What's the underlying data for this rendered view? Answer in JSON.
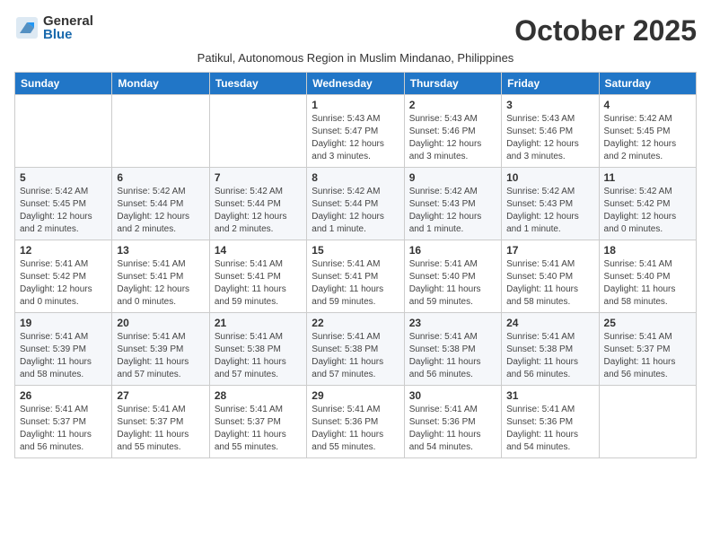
{
  "logo": {
    "general": "General",
    "blue": "Blue"
  },
  "title": "October 2025",
  "subtitle": "Patikul, Autonomous Region in Muslim Mindanao, Philippines",
  "weekdays": [
    "Sunday",
    "Monday",
    "Tuesday",
    "Wednesday",
    "Thursday",
    "Friday",
    "Saturday"
  ],
  "weeks": [
    [
      {
        "day": "",
        "sunrise": "",
        "sunset": "",
        "daylight": ""
      },
      {
        "day": "",
        "sunrise": "",
        "sunset": "",
        "daylight": ""
      },
      {
        "day": "",
        "sunrise": "",
        "sunset": "",
        "daylight": ""
      },
      {
        "day": "1",
        "sunrise": "Sunrise: 5:43 AM",
        "sunset": "Sunset: 5:47 PM",
        "daylight": "Daylight: 12 hours and 3 minutes."
      },
      {
        "day": "2",
        "sunrise": "Sunrise: 5:43 AM",
        "sunset": "Sunset: 5:46 PM",
        "daylight": "Daylight: 12 hours and 3 minutes."
      },
      {
        "day": "3",
        "sunrise": "Sunrise: 5:43 AM",
        "sunset": "Sunset: 5:46 PM",
        "daylight": "Daylight: 12 hours and 3 minutes."
      },
      {
        "day": "4",
        "sunrise": "Sunrise: 5:42 AM",
        "sunset": "Sunset: 5:45 PM",
        "daylight": "Daylight: 12 hours and 2 minutes."
      }
    ],
    [
      {
        "day": "5",
        "sunrise": "Sunrise: 5:42 AM",
        "sunset": "Sunset: 5:45 PM",
        "daylight": "Daylight: 12 hours and 2 minutes."
      },
      {
        "day": "6",
        "sunrise": "Sunrise: 5:42 AM",
        "sunset": "Sunset: 5:44 PM",
        "daylight": "Daylight: 12 hours and 2 minutes."
      },
      {
        "day": "7",
        "sunrise": "Sunrise: 5:42 AM",
        "sunset": "Sunset: 5:44 PM",
        "daylight": "Daylight: 12 hours and 2 minutes."
      },
      {
        "day": "8",
        "sunrise": "Sunrise: 5:42 AM",
        "sunset": "Sunset: 5:44 PM",
        "daylight": "Daylight: 12 hours and 1 minute."
      },
      {
        "day": "9",
        "sunrise": "Sunrise: 5:42 AM",
        "sunset": "Sunset: 5:43 PM",
        "daylight": "Daylight: 12 hours and 1 minute."
      },
      {
        "day": "10",
        "sunrise": "Sunrise: 5:42 AM",
        "sunset": "Sunset: 5:43 PM",
        "daylight": "Daylight: 12 hours and 1 minute."
      },
      {
        "day": "11",
        "sunrise": "Sunrise: 5:42 AM",
        "sunset": "Sunset: 5:42 PM",
        "daylight": "Daylight: 12 hours and 0 minutes."
      }
    ],
    [
      {
        "day": "12",
        "sunrise": "Sunrise: 5:41 AM",
        "sunset": "Sunset: 5:42 PM",
        "daylight": "Daylight: 12 hours and 0 minutes."
      },
      {
        "day": "13",
        "sunrise": "Sunrise: 5:41 AM",
        "sunset": "Sunset: 5:41 PM",
        "daylight": "Daylight: 12 hours and 0 minutes."
      },
      {
        "day": "14",
        "sunrise": "Sunrise: 5:41 AM",
        "sunset": "Sunset: 5:41 PM",
        "daylight": "Daylight: 11 hours and 59 minutes."
      },
      {
        "day": "15",
        "sunrise": "Sunrise: 5:41 AM",
        "sunset": "Sunset: 5:41 PM",
        "daylight": "Daylight: 11 hours and 59 minutes."
      },
      {
        "day": "16",
        "sunrise": "Sunrise: 5:41 AM",
        "sunset": "Sunset: 5:40 PM",
        "daylight": "Daylight: 11 hours and 59 minutes."
      },
      {
        "day": "17",
        "sunrise": "Sunrise: 5:41 AM",
        "sunset": "Sunset: 5:40 PM",
        "daylight": "Daylight: 11 hours and 58 minutes."
      },
      {
        "day": "18",
        "sunrise": "Sunrise: 5:41 AM",
        "sunset": "Sunset: 5:40 PM",
        "daylight": "Daylight: 11 hours and 58 minutes."
      }
    ],
    [
      {
        "day": "19",
        "sunrise": "Sunrise: 5:41 AM",
        "sunset": "Sunset: 5:39 PM",
        "daylight": "Daylight: 11 hours and 58 minutes."
      },
      {
        "day": "20",
        "sunrise": "Sunrise: 5:41 AM",
        "sunset": "Sunset: 5:39 PM",
        "daylight": "Daylight: 11 hours and 57 minutes."
      },
      {
        "day": "21",
        "sunrise": "Sunrise: 5:41 AM",
        "sunset": "Sunset: 5:38 PM",
        "daylight": "Daylight: 11 hours and 57 minutes."
      },
      {
        "day": "22",
        "sunrise": "Sunrise: 5:41 AM",
        "sunset": "Sunset: 5:38 PM",
        "daylight": "Daylight: 11 hours and 57 minutes."
      },
      {
        "day": "23",
        "sunrise": "Sunrise: 5:41 AM",
        "sunset": "Sunset: 5:38 PM",
        "daylight": "Daylight: 11 hours and 56 minutes."
      },
      {
        "day": "24",
        "sunrise": "Sunrise: 5:41 AM",
        "sunset": "Sunset: 5:38 PM",
        "daylight": "Daylight: 11 hours and 56 minutes."
      },
      {
        "day": "25",
        "sunrise": "Sunrise: 5:41 AM",
        "sunset": "Sunset: 5:37 PM",
        "daylight": "Daylight: 11 hours and 56 minutes."
      }
    ],
    [
      {
        "day": "26",
        "sunrise": "Sunrise: 5:41 AM",
        "sunset": "Sunset: 5:37 PM",
        "daylight": "Daylight: 11 hours and 56 minutes."
      },
      {
        "day": "27",
        "sunrise": "Sunrise: 5:41 AM",
        "sunset": "Sunset: 5:37 PM",
        "daylight": "Daylight: 11 hours and 55 minutes."
      },
      {
        "day": "28",
        "sunrise": "Sunrise: 5:41 AM",
        "sunset": "Sunset: 5:37 PM",
        "daylight": "Daylight: 11 hours and 55 minutes."
      },
      {
        "day": "29",
        "sunrise": "Sunrise: 5:41 AM",
        "sunset": "Sunset: 5:36 PM",
        "daylight": "Daylight: 11 hours and 55 minutes."
      },
      {
        "day": "30",
        "sunrise": "Sunrise: 5:41 AM",
        "sunset": "Sunset: 5:36 PM",
        "daylight": "Daylight: 11 hours and 54 minutes."
      },
      {
        "day": "31",
        "sunrise": "Sunrise: 5:41 AM",
        "sunset": "Sunset: 5:36 PM",
        "daylight": "Daylight: 11 hours and 54 minutes."
      },
      {
        "day": "",
        "sunrise": "",
        "sunset": "",
        "daylight": ""
      }
    ]
  ]
}
